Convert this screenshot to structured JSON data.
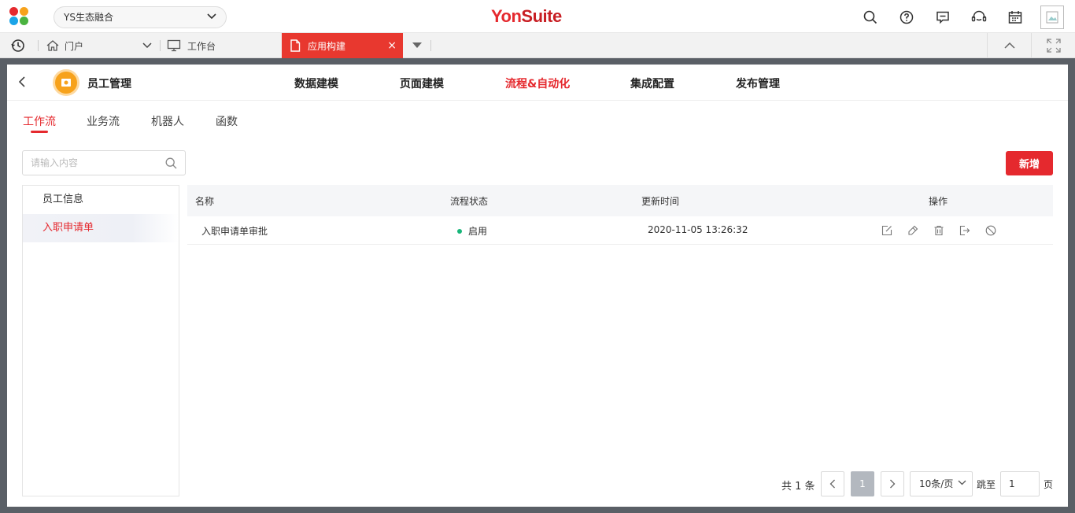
{
  "topbar": {
    "tenant": "YS生态融合",
    "brand_yon": "Yon",
    "brand_suite": "Suite",
    "icons": [
      "search-icon",
      "help-icon",
      "message-icon",
      "customer-service-icon",
      "calendar-icon",
      "avatar-image"
    ]
  },
  "tabbar": {
    "tabs": [
      {
        "label": "门户",
        "icon": "home-icon"
      },
      {
        "label": "工作台",
        "icon": "monitor-icon"
      },
      {
        "label": "应用构建",
        "icon": "document-icon",
        "active": true
      }
    ],
    "close": "×"
  },
  "app": {
    "name": "员工管理",
    "nav": [
      "数据建模",
      "页面建模",
      "流程&自动化",
      "集成配置",
      "发布管理"
    ],
    "active_nav": "流程&自动化"
  },
  "subtabs": {
    "items": [
      "工作流",
      "业务流",
      "机器人",
      "函数"
    ],
    "active": "工作流"
  },
  "search": {
    "placeholder": "请输入内容",
    "value": ""
  },
  "add_button": "新增",
  "tree": {
    "items": [
      {
        "label": "员工信息"
      },
      {
        "label": "入职申请单",
        "selected": true
      }
    ]
  },
  "table": {
    "columns": [
      "名称",
      "流程状态",
      "更新时间",
      "操作"
    ],
    "rows": [
      {
        "name": "入职申请单审批",
        "status": "启用",
        "updated": "2020-11-05 13:26:32",
        "ops": [
          "edit-icon",
          "design-icon",
          "delete-icon",
          "export-icon",
          "disable-icon"
        ]
      }
    ]
  },
  "pagination": {
    "total_label": "共 1 条",
    "current_page": "1",
    "page_size": "10条/页",
    "jump_label": "跳至",
    "jump_value": "1",
    "page_unit": "页"
  },
  "colors": {
    "accent": "#e5292e",
    "status_ok": "#18b67a"
  }
}
